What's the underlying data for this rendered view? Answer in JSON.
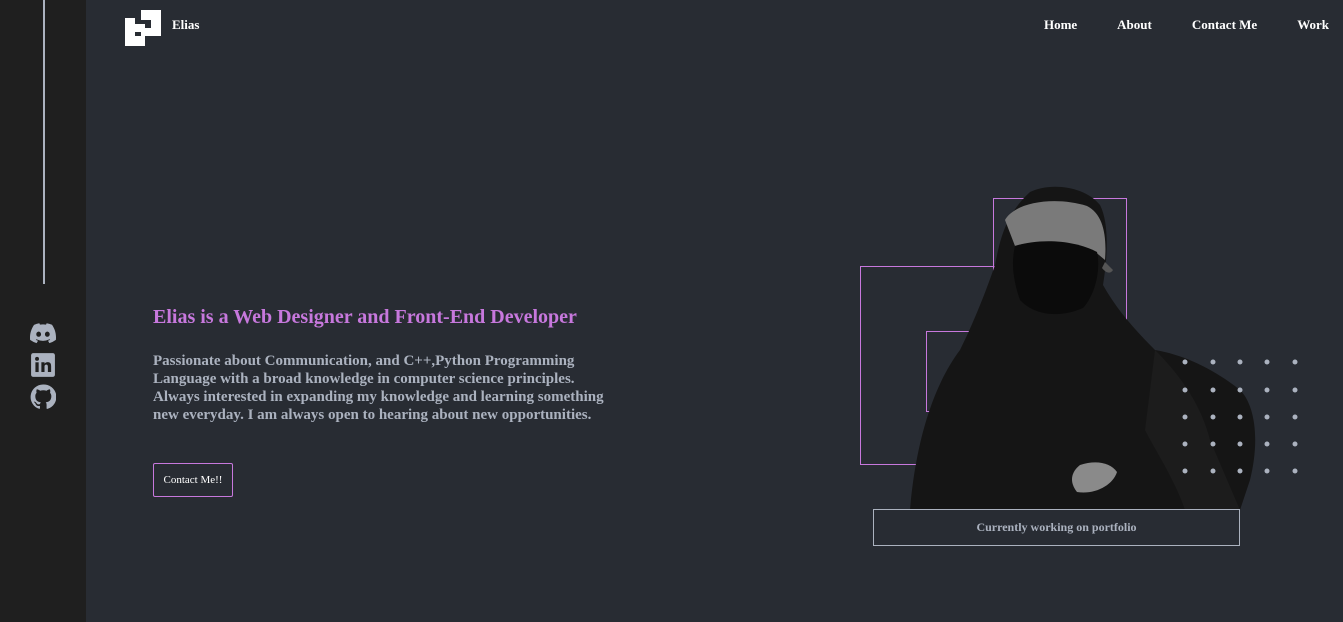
{
  "brand": {
    "name": "Elias",
    "logo_icon": "logo-icon"
  },
  "nav": {
    "items": [
      {
        "label": "Home"
      },
      {
        "label": "About"
      },
      {
        "label": "Contact Me"
      },
      {
        "label": "Work"
      }
    ]
  },
  "social": {
    "icons": [
      "discord-icon",
      "linkedin-icon",
      "github-icon"
    ]
  },
  "hero": {
    "title": "Elias is a Web Designer and Front-End Developer",
    "description": "Passionate about Communication, and C++,Python Programming Language with a broad knowledge in computer science principles. Always interested in expanding my knowledge and learning something new everyday. I am always open to hearing about new opportunities.",
    "cta_label": "Contact Me!!",
    "status": "Currently working on portfolio"
  },
  "colors": {
    "background": "#282c33",
    "sidebar": "#1f1f1f",
    "accent": "#c778dd",
    "text": "#abb2bf",
    "white": "#ffffff"
  }
}
